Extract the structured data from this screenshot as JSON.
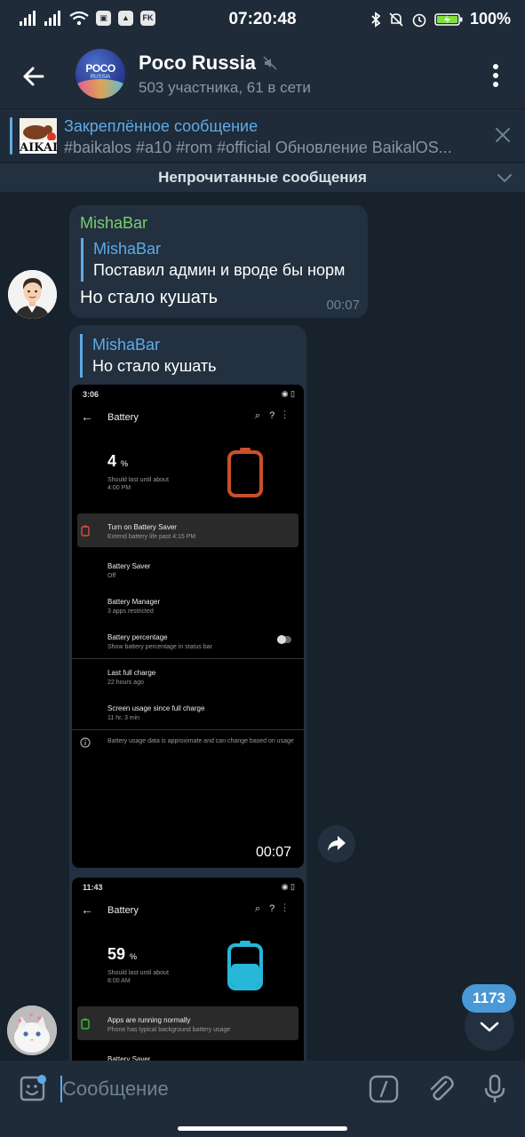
{
  "status_bar": {
    "time": "07:20:48",
    "battery": "100%",
    "app_badge": "FK"
  },
  "header": {
    "title": "Poco Russia",
    "subtitle": "503 участника, 61 в сети",
    "avatar_text": "POCO",
    "avatar_subtext": "RUSSIA"
  },
  "pinned": {
    "title": "Закреплённое сообщение",
    "text": "#baikalos #a10 #rom #official  Обновление BaikalOS..."
  },
  "unread_divider": {
    "label": "Непрочитанные сообщения"
  },
  "messages": [
    {
      "sender": "MishaBar",
      "reply_name": "MishaBar",
      "reply_text": "Поставил админ и вроде бы норм",
      "text": "Но стало кушать",
      "time": "00:07"
    },
    {
      "reply_name": "MishaBar",
      "reply_text": "Но стало кушать",
      "screenshots": [
        {
          "time": "3:06",
          "title": "Battery",
          "percent": "4",
          "percent_unit": "%",
          "estimate_1": "Should last until about",
          "estimate_2": "4:00 PM",
          "battery_level": 0.04,
          "battery_color": "#c9502b",
          "rows": [
            {
              "title": "Turn on Battery Saver",
              "sub": "Extend battery life past 4:15 PM"
            },
            {
              "title": "Battery Saver",
              "sub": "Off"
            },
            {
              "title": "Battery Manager",
              "sub": "3 apps restricted"
            },
            {
              "title": "Battery percentage",
              "sub": "Show battery percentage in status bar"
            },
            {
              "title": "Last full charge",
              "sub": "22 hours ago"
            },
            {
              "title": "Screen usage since full charge",
              "sub": "11 hr, 3 min"
            }
          ],
          "info": "Battery usage data is approximate and can change based on usage",
          "duration": "00:07"
        },
        {
          "time": "11:43",
          "title": "Battery",
          "percent": "59",
          "percent_unit": "%",
          "estimate_1": "Should last until about",
          "estimate_2": "8:00 AM",
          "battery_level": 0.59,
          "battery_color": "#27b7d8",
          "rows": [
            {
              "title": "Apps are running normally",
              "sub": "Phone has typical background battery usage"
            },
            {
              "title": "Battery Saver",
              "sub": ""
            }
          ]
        }
      ]
    }
  ],
  "scroll": {
    "unread_count": "1173"
  },
  "composer": {
    "placeholder": "Сообщение",
    "command_symbol": "/"
  },
  "colors": {
    "accent": "#5eabe7",
    "sender": "#7ccf6a",
    "bubble": "#223040",
    "background": "#18222d",
    "bar": "#1f2b38"
  }
}
